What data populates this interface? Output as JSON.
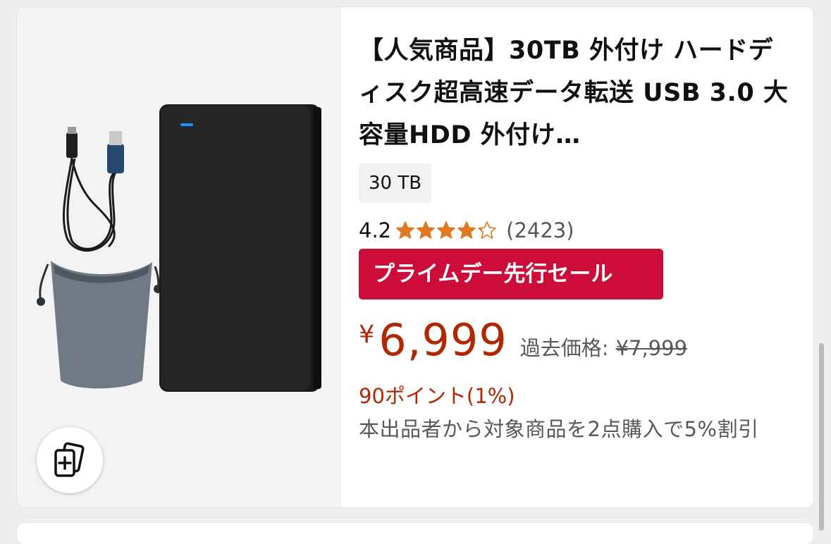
{
  "product": {
    "title": "【人気商品】30TB 外付け ハードディスク超高速データ転送 USB 3.0 大容量HDD 外付け…",
    "variant": "30 TB",
    "rating": "4.2",
    "rating_value": 4.2,
    "stars_max": 5,
    "review_count": "(2423)",
    "deal_badge": "プライムデー先行セール",
    "currency": "¥",
    "price": "6,999",
    "past_price_label": "過去価格:",
    "past_price": "¥7,999",
    "points": "90ポイント(1%)",
    "promotion": "本出品者から対象商品を2点購入で5%割引"
  },
  "icons": {
    "compare": "add-to-compare-icon",
    "star": "star-icon"
  },
  "colors": {
    "price": "#b12704",
    "deal_badge": "#cc0c39",
    "star": "#de7921",
    "secondary_text": "#565959"
  }
}
